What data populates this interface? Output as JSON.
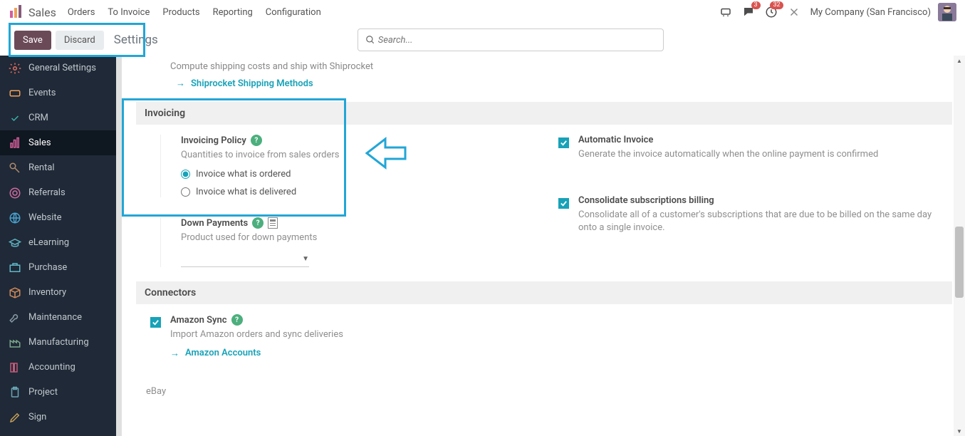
{
  "topnav": {
    "brand": "Sales",
    "items": [
      "Orders",
      "To Invoice",
      "Products",
      "Reporting",
      "Configuration"
    ],
    "chat_badge": "3",
    "clock_badge": "32",
    "company": "My Company (San Francisco)"
  },
  "actions": {
    "save": "Save",
    "discard": "Discard",
    "crumb": "Settings",
    "search_placeholder": "Search..."
  },
  "sidebar": {
    "items": [
      {
        "label": "General Settings",
        "icon": "gear",
        "color": "#e86c5d"
      },
      {
        "label": "Events",
        "icon": "ticket",
        "color": "#f0a05a"
      },
      {
        "label": "CRM",
        "icon": "handshake",
        "color": "#3bb0a8"
      },
      {
        "label": "Sales",
        "icon": "bars",
        "active": true,
        "color": "#d45f9b"
      },
      {
        "label": "Rental",
        "icon": "key",
        "color": "#b08b6e"
      },
      {
        "label": "Referrals",
        "icon": "target",
        "color": "#d06ba0"
      },
      {
        "label": "Website",
        "icon": "globe",
        "color": "#4aa3d0"
      },
      {
        "label": "eLearning",
        "icon": "cap",
        "color": "#5fb0c0"
      },
      {
        "label": "Purchase",
        "icon": "cart",
        "color": "#5fb8c8"
      },
      {
        "label": "Inventory",
        "icon": "box",
        "color": "#d08a5a"
      },
      {
        "label": "Maintenance",
        "icon": "wrench",
        "color": "#8a9aa5"
      },
      {
        "label": "Manufacturing",
        "icon": "factory",
        "color": "#7aa88a"
      },
      {
        "label": "Accounting",
        "icon": "books",
        "color": "#c05a7a"
      },
      {
        "label": "Project",
        "icon": "clipboard",
        "color": "#6aa5b5"
      },
      {
        "label": "Sign",
        "icon": "pen",
        "color": "#c5a05a"
      }
    ]
  },
  "content": {
    "ship_desc": "Compute shipping costs and ship with Shiprocket",
    "ship_link": "Shiprocket Shipping Methods",
    "invoicing": {
      "title": "Invoicing",
      "policy": {
        "title": "Invoicing Policy",
        "desc": "Quantities to invoice from sales orders",
        "r1": "Invoice what is ordered",
        "r2": "Invoice what is delivered"
      },
      "auto": {
        "title": "Automatic Invoice",
        "desc": "Generate the invoice automatically when the online payment is confirmed"
      },
      "down": {
        "title": "Down Payments",
        "desc": "Product used for down payments"
      },
      "consol": {
        "title": "Consolidate subscriptions billing",
        "desc": "Consolidate all of a customer's subscriptions that are due to be billed on the same day onto a single invoice."
      }
    },
    "connectors": {
      "title": "Connectors",
      "amazon": {
        "title": "Amazon Sync",
        "desc": "Import Amazon orders and sync deliveries",
        "link": "Amazon Accounts"
      }
    },
    "ebay": "eBay"
  }
}
